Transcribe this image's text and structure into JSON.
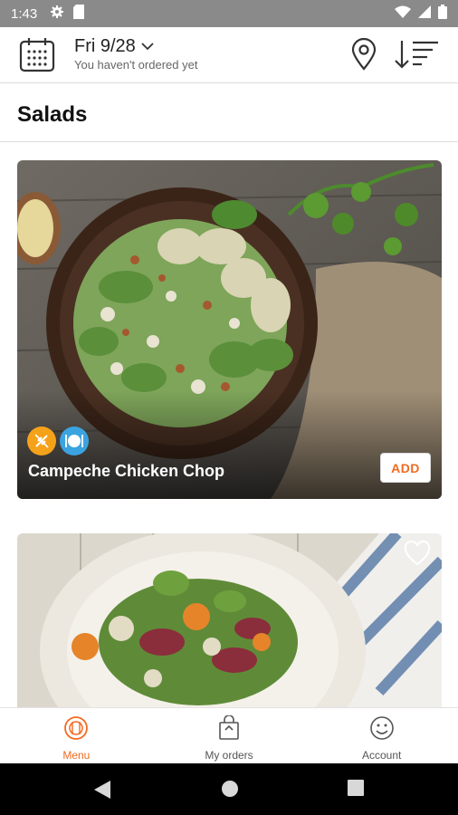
{
  "status_bar": {
    "time": "1:43",
    "icons": [
      "gear-icon",
      "sd-card-icon",
      "wifi-icon",
      "signal-icon",
      "battery-icon"
    ]
  },
  "header": {
    "date": "Fri 9/28",
    "subtitle": "You haven't ordered yet",
    "icons": [
      "calendar-icon",
      "chevron-down-icon",
      "location-pin-icon",
      "sort-icon"
    ]
  },
  "section": {
    "title": "Salads"
  },
  "items": [
    {
      "name": "Campeche Chicken Chop",
      "add_label": "ADD",
      "badges": [
        "wheat-icon",
        "plate-icon"
      ],
      "colors": {
        "badge1": "#f5a21b",
        "badge2": "#3ba3e0"
      }
    },
    {
      "name": "",
      "icons": [
        "heart-icon"
      ]
    }
  ],
  "bottom_nav": {
    "items": [
      {
        "label": "Menu",
        "icon": "menu-icon",
        "active": true
      },
      {
        "label": "My orders",
        "icon": "orders-bag-icon",
        "active": false
      },
      {
        "label": "Account",
        "icon": "account-face-icon",
        "active": false
      }
    ]
  },
  "colors": {
    "accent": "#f26a21",
    "status_bar": "#8a8a8a",
    "divider": "#dcdcdc"
  },
  "system_nav": [
    "back-icon",
    "home-icon",
    "recents-icon"
  ]
}
